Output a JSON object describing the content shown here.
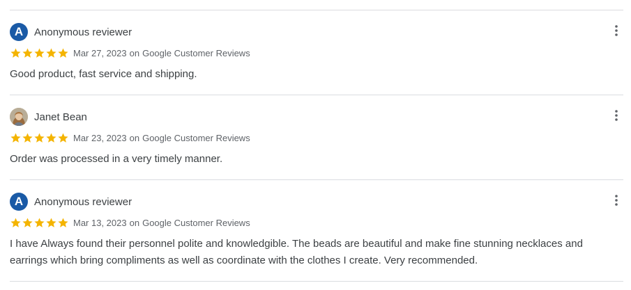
{
  "colors": {
    "star": "#f4b400",
    "avatar_bg": "#1a5aa6",
    "divider": "#dadce0",
    "text": "#3c4043",
    "meta_text": "#5f6368"
  },
  "reviews": [
    {
      "avatar_type": "letter",
      "avatar_letter": "A",
      "reviewer": "Anonymous reviewer",
      "rating": 5,
      "date": "Mar 27, 2023",
      "source_prefix": "on",
      "source": "Google Customer Reviews",
      "text": "Good product, fast service and shipping.",
      "menu_icon": "more-vert-icon"
    },
    {
      "avatar_type": "photo",
      "avatar_letter": "",
      "reviewer": "Janet Bean",
      "rating": 5,
      "date": "Mar 23, 2023",
      "source_prefix": "on",
      "source": "Google Customer Reviews",
      "text": "Order was processed in a very timely manner.",
      "menu_icon": "more-vert-icon"
    },
    {
      "avatar_type": "letter",
      "avatar_letter": "A",
      "reviewer": "Anonymous reviewer",
      "rating": 5,
      "date": "Mar 13, 2023",
      "source_prefix": "on",
      "source": "Google Customer Reviews",
      "text": "I have Always found their personnel polite and knowledgible. The beads are beautiful and make fine stunning necklaces and earrings which bring compliments as well as coordinate with the clothes I create. Very recommended.",
      "menu_icon": "more-vert-icon"
    }
  ]
}
